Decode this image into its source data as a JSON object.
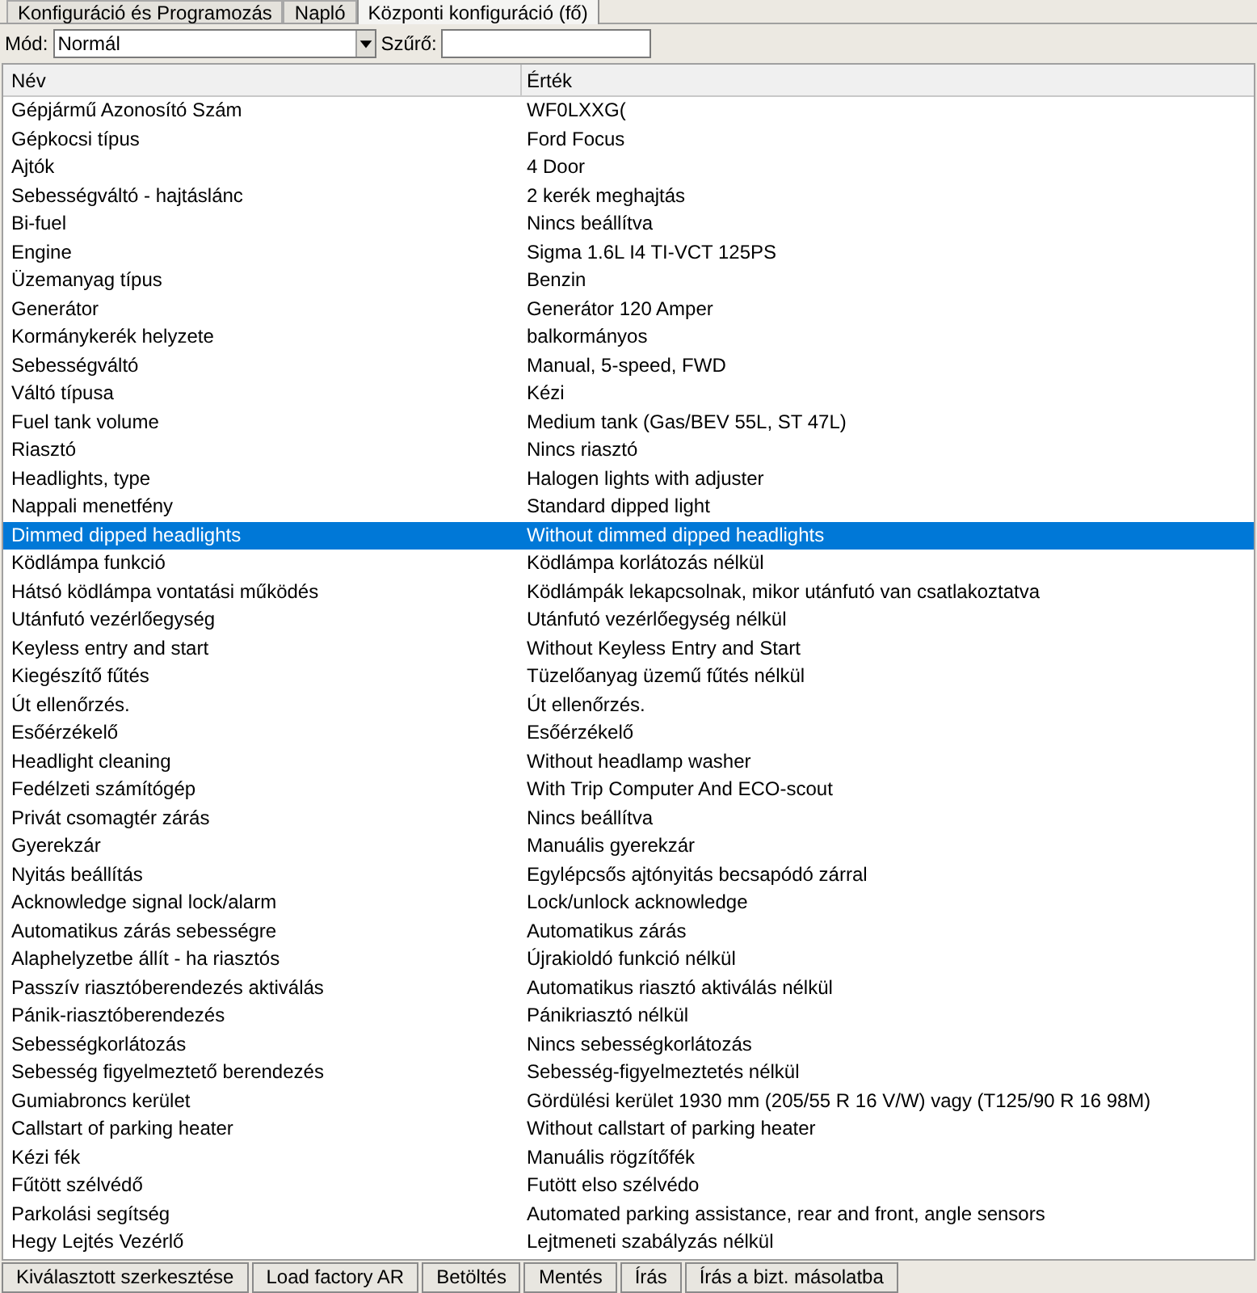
{
  "tabs": [
    {
      "label": "Konfiguráció és Programozás",
      "selected": false
    },
    {
      "label": "Napló",
      "selected": false
    },
    {
      "label": "Központi konfiguráció (fő)",
      "selected": true
    }
  ],
  "toolbar": {
    "mode_label": "Mód:",
    "mode_value": "Normál",
    "filter_label": "Szűrő:"
  },
  "table": {
    "columns": [
      "Név",
      "Érték"
    ],
    "rows": [
      {
        "name": "Gépjármű Azonosító Szám",
        "value": "WF0LXXG(",
        "selected": false
      },
      {
        "name": "Gépkocsi típus",
        "value": "Ford Focus",
        "selected": false
      },
      {
        "name": "Ajtók",
        "value": "4 Door",
        "selected": false
      },
      {
        "name": "Sebességváltó - hajtáslánc",
        "value": "2 kerék meghajtás",
        "selected": false
      },
      {
        "name": "Bi-fuel",
        "value": "Nincs beállítva",
        "selected": false
      },
      {
        "name": "Engine",
        "value": "Sigma 1.6L I4 TI-VCT 125PS",
        "selected": false
      },
      {
        "name": "Üzemanyag típus",
        "value": "Benzin",
        "selected": false
      },
      {
        "name": "Generátor",
        "value": "Generátor 120 Amper",
        "selected": false
      },
      {
        "name": "Kormánykerék helyzete",
        "value": "balkormányos",
        "selected": false
      },
      {
        "name": "Sebességváltó",
        "value": "Manual, 5-speed, FWD",
        "selected": false
      },
      {
        "name": "Váltó típusa",
        "value": "Kézi",
        "selected": false
      },
      {
        "name": "Fuel tank volume",
        "value": "Medium tank (Gas/BEV 55L, ST 47L)",
        "selected": false
      },
      {
        "name": "Riasztó",
        "value": "Nincs riasztó",
        "selected": false
      },
      {
        "name": "Headlights, type",
        "value": "Halogen lights with adjuster",
        "selected": false
      },
      {
        "name": "Nappali menetfény",
        "value": "Standard dipped light",
        "selected": false
      },
      {
        "name": "Dimmed dipped headlights",
        "value": "Without dimmed dipped headlights",
        "selected": true
      },
      {
        "name": "Ködlámpa funkció",
        "value": "Ködlámpa korlátozás nélkül",
        "selected": false
      },
      {
        "name": "Hátsó ködlámpa vontatási működés",
        "value": "Ködlámpák lekapcsolnak, mikor utánfutó van csatlakoztatva",
        "selected": false
      },
      {
        "name": "Utánfutó vezérlőegység",
        "value": "Utánfutó vezérlőegység nélkül",
        "selected": false
      },
      {
        "name": "Keyless entry and start",
        "value": "Without Keyless Entry and Start",
        "selected": false
      },
      {
        "name": "Kiegészítő fűtés",
        "value": "Tüzelőanyag üzemű fűtés nélkül",
        "selected": false
      },
      {
        "name": "Út ellenőrzés.",
        "value": "Út ellenőrzés.",
        "selected": false
      },
      {
        "name": "Esőérzékelő",
        "value": "Esőérzékelő",
        "selected": false
      },
      {
        "name": "Headlight cleaning",
        "value": "Without headlamp washer",
        "selected": false
      },
      {
        "name": "Fedélzeti számítógép",
        "value": "With Trip Computer And ECO-scout",
        "selected": false
      },
      {
        "name": "Privát csomagtér zárás",
        "value": "Nincs beállítva",
        "selected": false
      },
      {
        "name": "Gyerekzár",
        "value": "Manuális gyerekzár",
        "selected": false
      },
      {
        "name": "Nyitás beállítás",
        "value": "Egylépcsős ajtónyitás becsapódó zárral",
        "selected": false
      },
      {
        "name": "Acknowledge signal lock/alarm",
        "value": "Lock/unlock acknowledge",
        "selected": false
      },
      {
        "name": "Automatikus zárás sebességre",
        "value": "Automatikus zárás",
        "selected": false
      },
      {
        "name": "Alaphelyzetbe állít - ha riasztós",
        "value": "Újrakioldó funkció nélkül",
        "selected": false
      },
      {
        "name": "Passzív riasztóberendezés aktiválás",
        "value": "Automatikus riasztó aktiválás nélkül",
        "selected": false
      },
      {
        "name": "Pánik-riasztóberendezés",
        "value": "Pánikriasztó nélkül",
        "selected": false
      },
      {
        "name": "Sebességkorlátozás",
        "value": "Nincs sebességkorlátozás",
        "selected": false
      },
      {
        "name": "Sebesség figyelmeztető berendezés",
        "value": "Sebesség-figyelmeztetés nélkül",
        "selected": false
      },
      {
        "name": "Gumiabroncs kerület",
        "value": "Gördülési kerület 1930 mm (205/55 R 16 V/W) vagy (T125/90 R 16 98M)",
        "selected": false
      },
      {
        "name": "Callstart of parking heater",
        "value": "Without callstart of parking heater",
        "selected": false
      },
      {
        "name": "Kézi fék",
        "value": "Manuális rögzítőfék",
        "selected": false
      },
      {
        "name": "Fűtött szélvédő",
        "value": "Futött elso szélvédo",
        "selected": false
      },
      {
        "name": "Parkolási segítség",
        "value": "Automated parking assistance, rear and front, angle sensors",
        "selected": false
      },
      {
        "name": "Hegy Lejtés Vezérlő",
        "value": "Lejtmeneti szabályzás nélkül",
        "selected": false
      }
    ]
  },
  "buttons": [
    "Kiválasztott szerkesztése",
    "Load factory AR",
    "Betöltés",
    "Mentés",
    "Írás",
    "Írás a bizt. másolatba"
  ]
}
